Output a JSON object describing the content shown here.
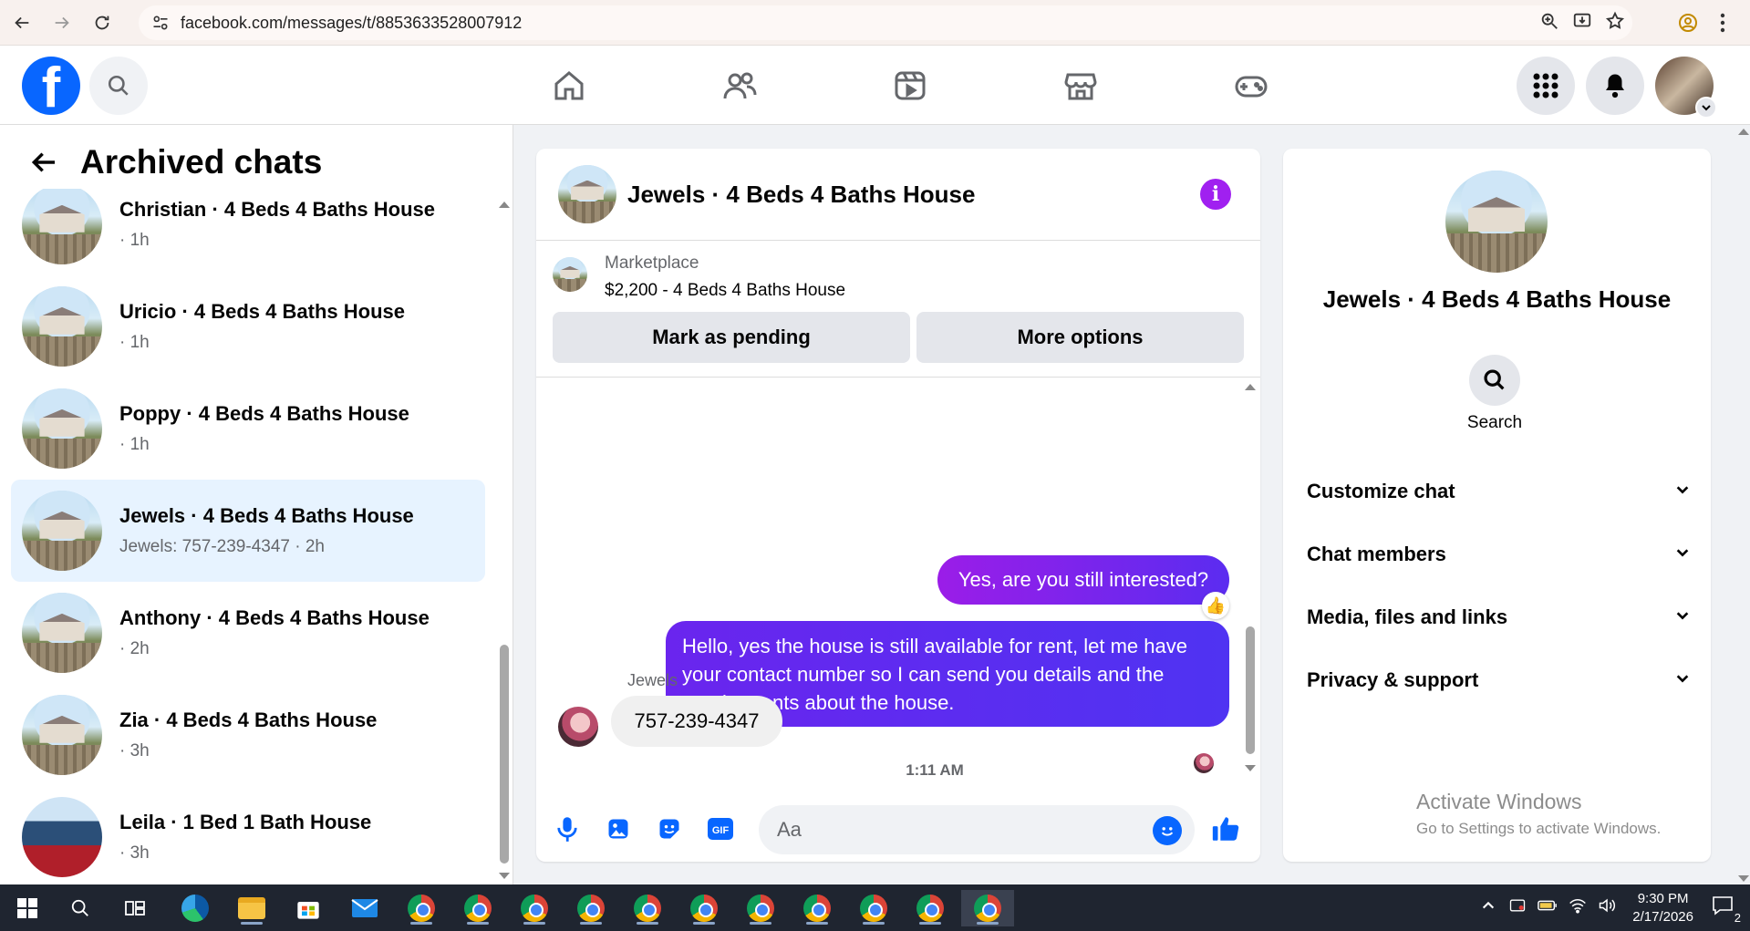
{
  "browser": {
    "url": "facebook.com/messages/t/8853633528007912"
  },
  "left": {
    "title": "Archived chats",
    "chats": [
      {
        "name": "Christian · 4 Beds 4 Baths House",
        "sub": "· 1h",
        "thumb": "house",
        "active": false
      },
      {
        "name": "Uricio · 4 Beds 4 Baths House",
        "sub": "· 1h",
        "thumb": "house",
        "active": false
      },
      {
        "name": "Poppy · 4 Beds 4 Baths House",
        "sub": "· 1h",
        "thumb": "house",
        "active": false
      },
      {
        "name": "Jewels · 4 Beds 4 Baths House",
        "sub": "Jewels: 757-239-4347 · 2h",
        "thumb": "house",
        "active": true
      },
      {
        "name": "Anthony · 4 Beds 4 Baths House",
        "sub": "· 2h",
        "thumb": "house",
        "active": false
      },
      {
        "name": "Zia · 4 Beds 4 Baths House",
        "sub": "· 3h",
        "thumb": "house",
        "active": false
      },
      {
        "name": "Leila · 1 Bed 1 Bath House",
        "sub": "· 3h",
        "thumb": "house2",
        "active": false
      }
    ]
  },
  "chat": {
    "title": "Jewels · 4 Beds 4 Baths House",
    "marketplace_label": "Marketplace",
    "listing": "$2,200 - 4 Beds 4 Baths House",
    "mark_pending": "Mark as pending",
    "more_options": "More options",
    "msg_out_1": "Yes, are you still interested?",
    "msg_out_2": "Hello, yes the house is still available for rent, let me have your contact number so I can send you details and the requirements about the house.",
    "reaction": "👍",
    "time_separator": "1:11 AM",
    "sender_name": "Jewels",
    "msg_in_1": "757-239-4347",
    "composer_placeholder": "Aa"
  },
  "details": {
    "title": "Jewels · 4 Beds 4 Baths House",
    "search_label": "Search",
    "sections": [
      "Customize chat",
      "Chat members",
      "Media, files and links",
      "Privacy & support"
    ]
  },
  "watermark": {
    "line1": "Activate Windows",
    "line2": "Go to Settings to activate Windows."
  },
  "taskbar": {
    "time": "9:30 PM",
    "date": "2/17/2026",
    "notification_count": "2"
  },
  "colors": {
    "fb_blue": "#0866ff",
    "outgoing_start": "#9b1de8",
    "outgoing_end": "#5b2cf0",
    "active_row": "#e7f3ff"
  }
}
